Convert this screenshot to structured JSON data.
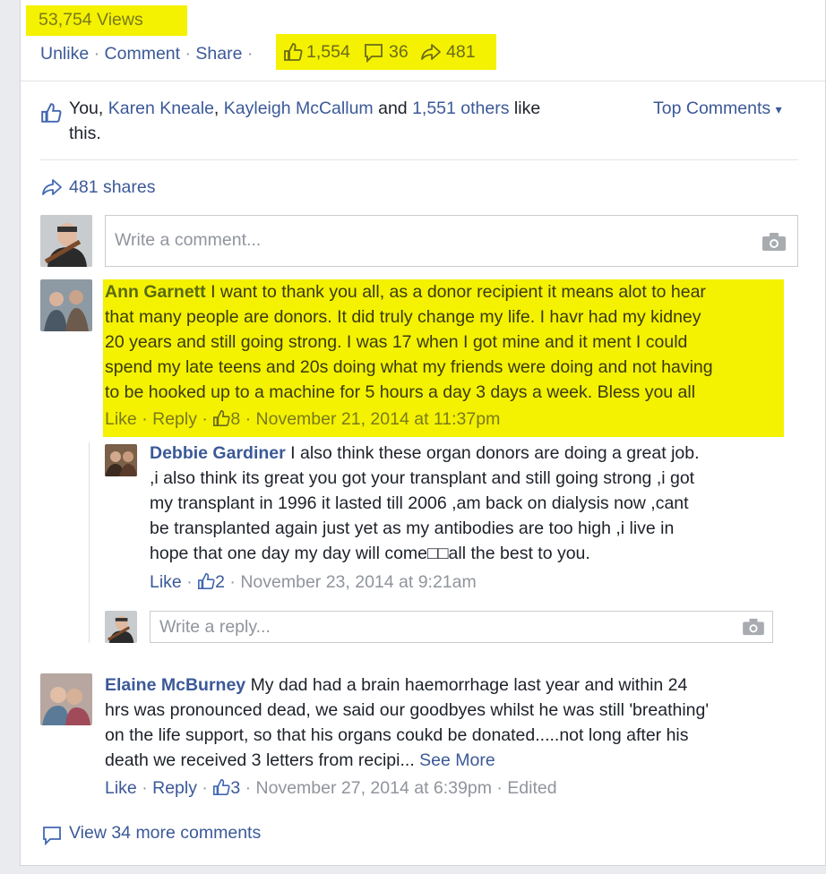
{
  "post": {
    "views": "53,754 Views",
    "actions": {
      "unlike": "Unlike",
      "comment": "Comment",
      "share": "Share",
      "dot": "·"
    },
    "counts": {
      "likes": "1,554",
      "comments": "36",
      "shares": "481"
    }
  },
  "likes_summary": {
    "you": "You,",
    "person1": "Karen Kneale",
    "comma": ",",
    "person2": "Kayleigh McCallum",
    "and": "and",
    "others": "1,551 others",
    "like_this_1": "like",
    "like_this_2": "this."
  },
  "sort": {
    "label": "Top Comments",
    "arrow": "▾"
  },
  "shares_summary": {
    "label": "481 shares"
  },
  "composer": {
    "placeholder": "Write a comment..."
  },
  "comments": [
    {
      "author": "Ann Garnett",
      "lines": [
        "I want to thank you all, as a donor recipient it means alot to hear",
        "that many people are donors. It did truly change my life. I havr had my kidney",
        "20 years and still going strong. I was 17 when I got mine and it ment I could",
        "spend my late teens and 20s doing what my friends were doing and not having",
        "to be hooked up to a machine for 5 hours a day 3 days a week. Bless you all"
      ],
      "like": "Like",
      "reply": "Reply",
      "likes": "8",
      "date": "November 21, 2014 at 11:37pm"
    },
    {
      "author": "Elaine McBurney",
      "lines": [
        "My dad had a brain haemorrhage last year and within 24",
        "hrs was pronounced dead, we said our goodbyes whilst he was still 'breathing'",
        "on the life support, so that his organs coukd be donated.....not long after his",
        "death we received 3 letters from recipi..."
      ],
      "see_more": "See More",
      "like": "Like",
      "reply": "Reply",
      "likes": "3",
      "date": "November 27, 2014 at 6:39pm",
      "edited": "Edited"
    }
  ],
  "reply": {
    "author": "Debbie Gardiner",
    "lines": [
      "I also think these organ donors are doing a great job.",
      ",i also think its great you got your transplant and still going strong ,i got",
      "my transplant in 1996 it lasted till 2006 ,am back on dialysis now ,cant",
      "be transplanted again just yet as my antibodies are too high ,i live in",
      "hope that one day my day will come□□all the best to you."
    ],
    "like": "Like",
    "likes": "2",
    "date": "November 23, 2014 at 9:21am"
  },
  "reply_composer": {
    "placeholder": "Write a reply..."
  },
  "view_more": {
    "label": "View 34 more comments"
  },
  "colors": {
    "highlight": "#f4f200",
    "link": "#3b5998",
    "meta": "#90949c"
  }
}
